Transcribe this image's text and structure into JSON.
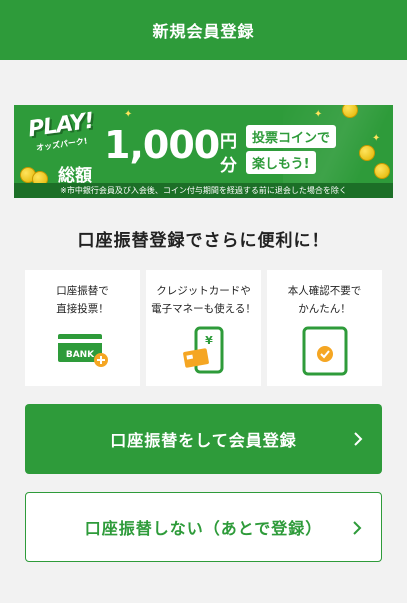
{
  "header": {
    "title": "新規会員登録"
  },
  "banner": {
    "logo": "PLAY!",
    "logo_sub": "オッズパーク!",
    "total_label": "総額",
    "amount": "1,000",
    "unit_top": "円",
    "unit_bottom": "分",
    "tag_top": "投票コインで",
    "tag_bottom": "楽しもう!",
    "note": "※市中銀行会員及び入会後、コイン付与期間を経過する前に退会した場合を除く"
  },
  "subtitle": "口座振替登録でさらに便利に！",
  "features": [
    {
      "text": "口座振替で\n直接投票！",
      "icon": "bank-card-icon",
      "icon_label": "BANK"
    },
    {
      "text": "クレジットカードや\n電子マネーも使える！",
      "icon": "phone-card-icon",
      "icon_label": "¥"
    },
    {
      "text": "本人確認不要で\nかんたん！",
      "icon": "phone-check-icon"
    }
  ],
  "buttons": {
    "primary": "口座振替をして会員登録",
    "secondary": "口座振替しない（あとで登録）"
  },
  "colors": {
    "brand_green": "#2e9b3a",
    "coin_yellow": "#ffe45c",
    "accent_orange": "#f5a623"
  }
}
